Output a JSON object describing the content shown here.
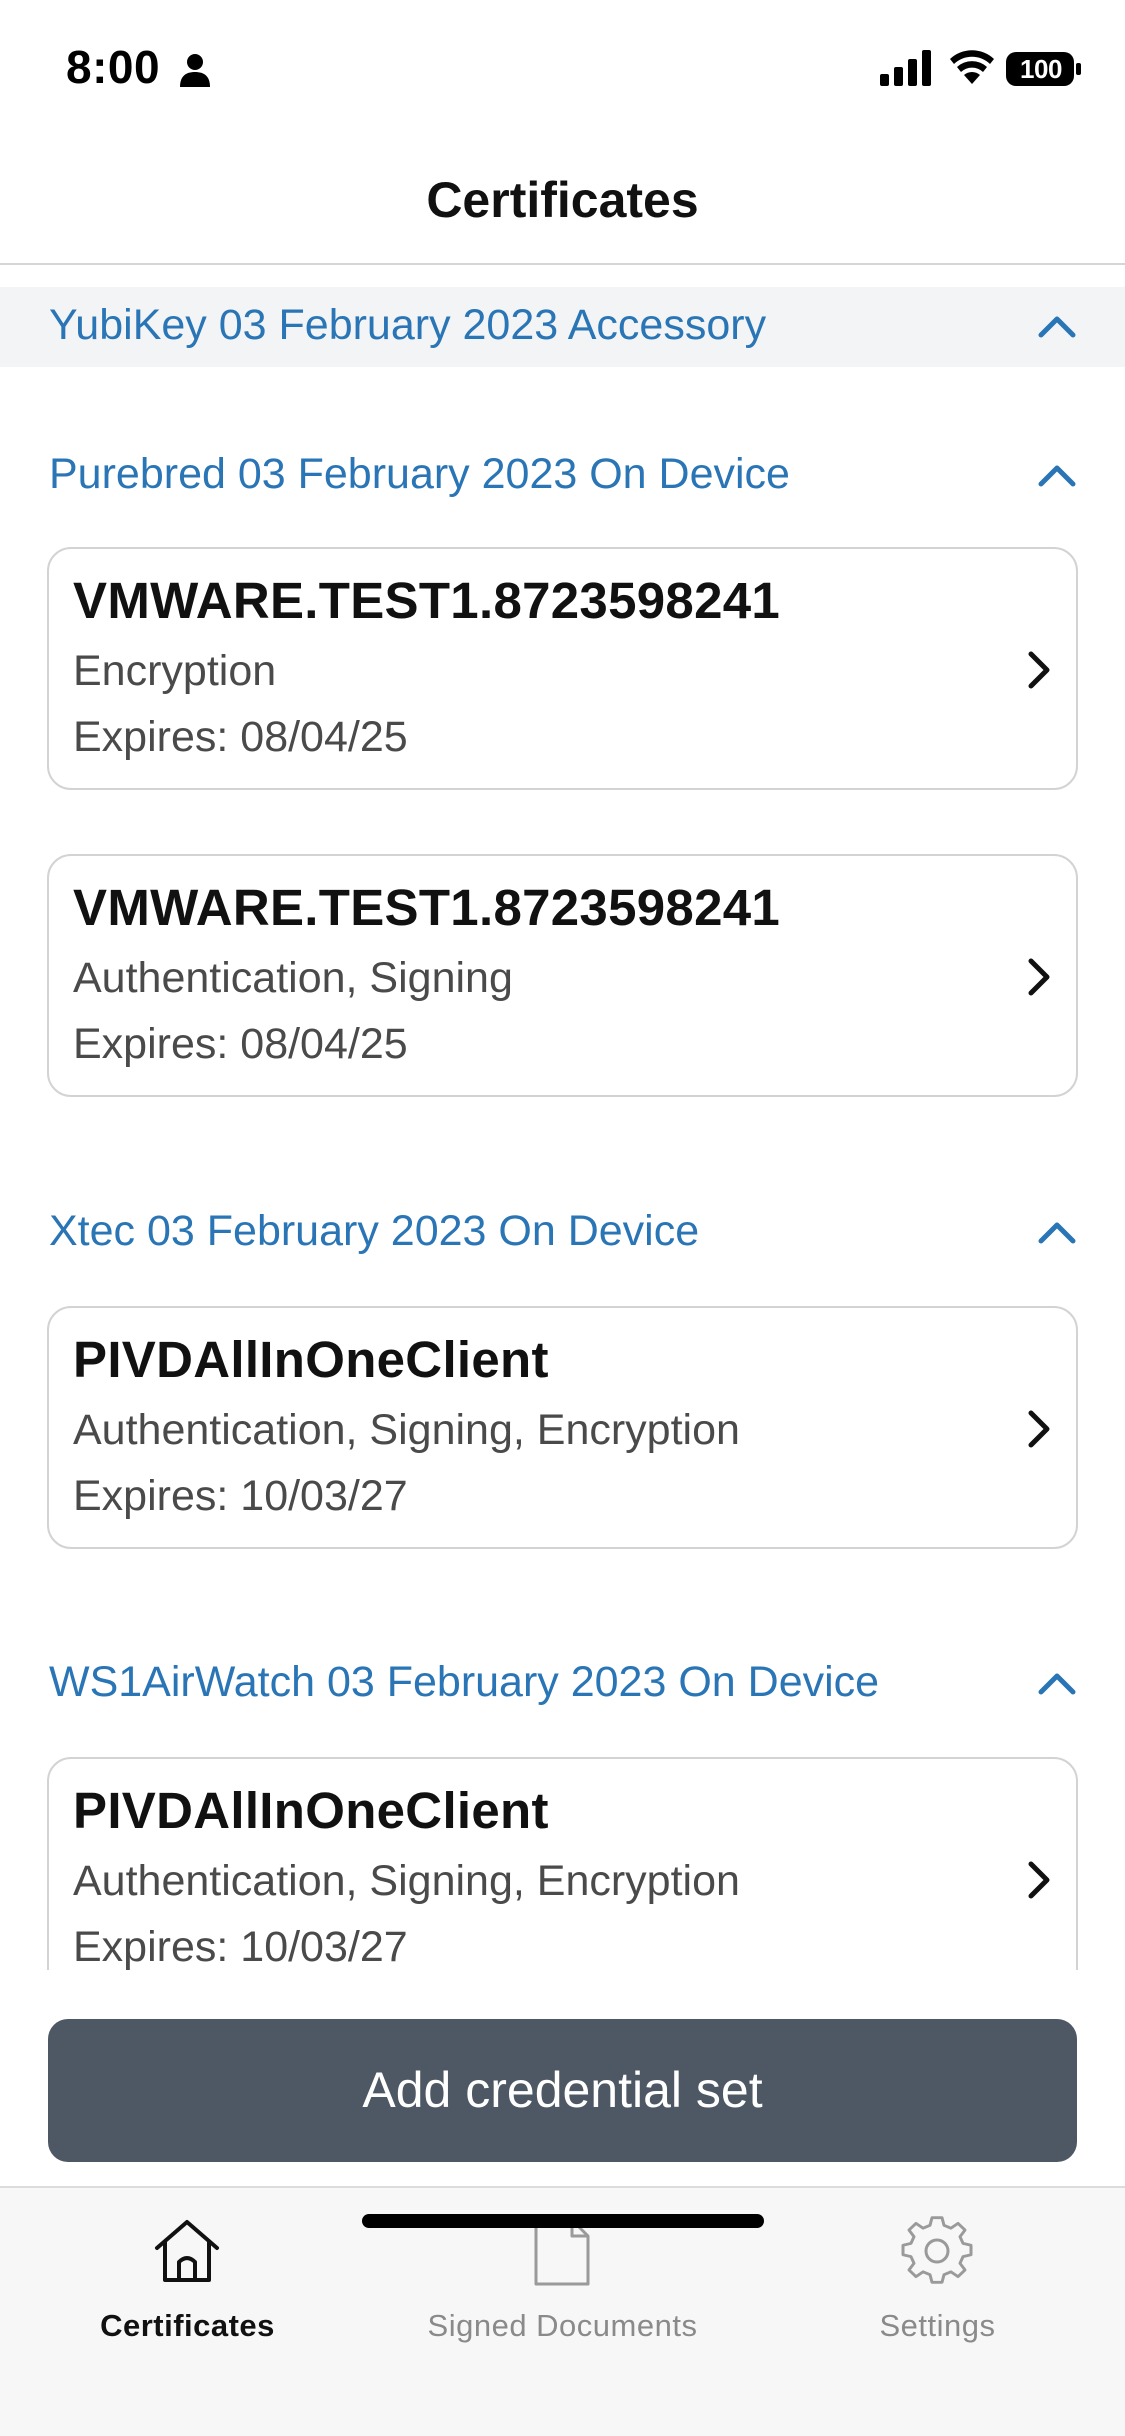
{
  "status_bar": {
    "time": "8:00",
    "battery": "100",
    "icons": [
      "person-icon",
      "signal-icon",
      "wifi-icon",
      "battery-icon"
    ]
  },
  "nav": {
    "title": "Certificates"
  },
  "groups": [
    {
      "title": "YubiKey 03 February 2023 Accessory",
      "expanded": true,
      "certificates": []
    },
    {
      "title": "Purebred 03 February 2023 On Device",
      "expanded": true,
      "certificates": [
        {
          "name": "VMWARE.TEST1.8723598241",
          "usage": "Encryption",
          "expires": "Expires: 08/04/25"
        },
        {
          "name": "VMWARE.TEST1.8723598241",
          "usage": "Authentication, Signing",
          "expires": "Expires: 08/04/25"
        }
      ]
    },
    {
      "title": "Xtec 03 February 2023 On Device",
      "expanded": true,
      "certificates": [
        {
          "name": "PIVDAllInOneClient",
          "usage": "Authentication, Signing, Encryption",
          "expires": "Expires: 10/03/27"
        }
      ]
    },
    {
      "title": "WS1AirWatch 03 February 2023 On Device",
      "expanded": true,
      "certificates": [
        {
          "name": "PIVDAllInOneClient",
          "usage": "Authentication, Signing, Encryption",
          "expires": "Expires: 10/03/27"
        }
      ]
    }
  ],
  "actions": {
    "add_credential_set": "Add credential set"
  },
  "tabs": [
    {
      "label": "Certificates",
      "icon": "home-icon",
      "active": true
    },
    {
      "label": "Signed Documents",
      "icon": "document-icon",
      "active": false
    },
    {
      "label": "Settings",
      "icon": "gear-icon",
      "active": false
    }
  ],
  "colors": {
    "accent": "#2a75b5",
    "button": "#4d5864",
    "header_shade": "#f2f4f6"
  }
}
